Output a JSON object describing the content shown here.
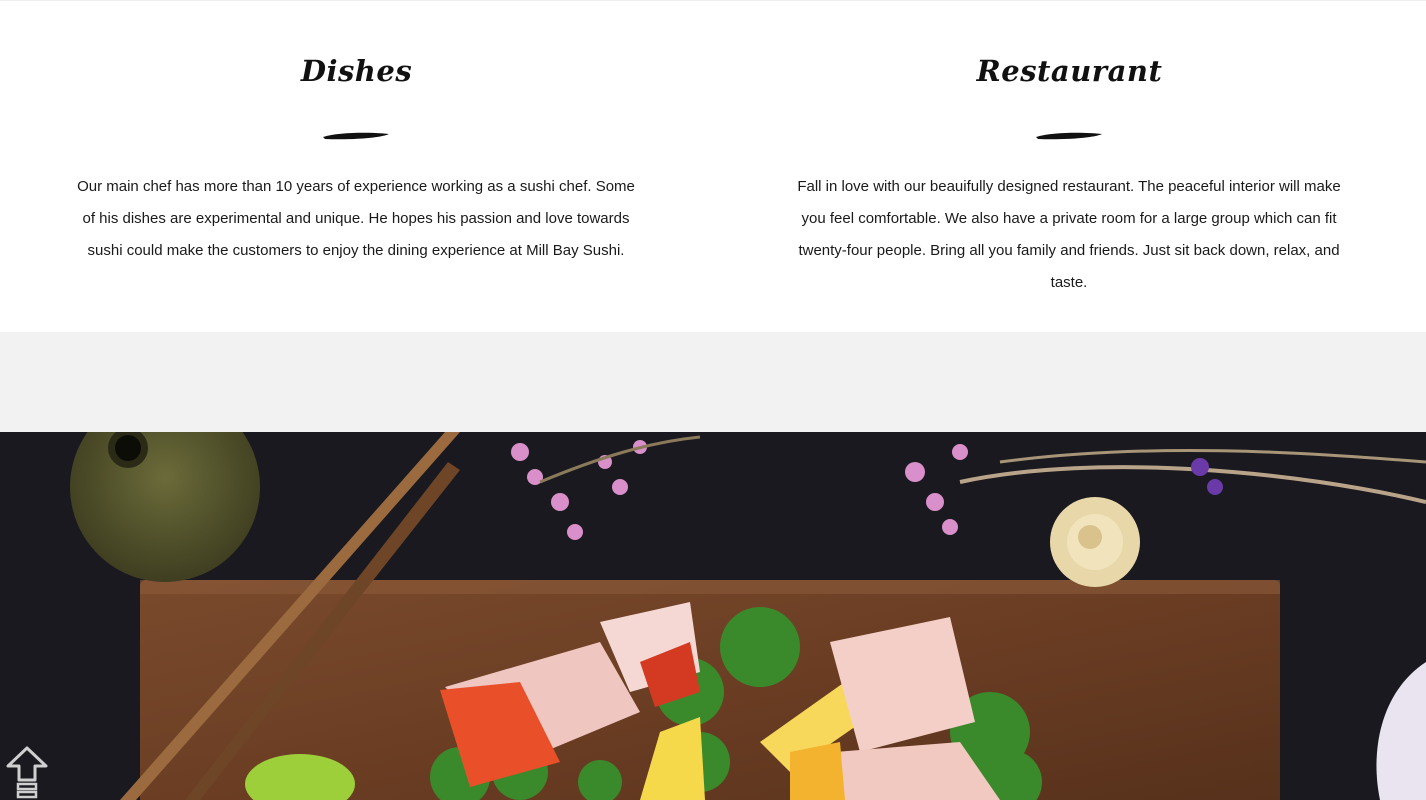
{
  "features": [
    {
      "title": "Dishes",
      "text": "Our main chef has more than 10 years of experience working as a sushi chef. Some of his dishes are experimental and unique. He hopes his passion and love towards sushi could make the customers to enjoy the dining experience at Mill Bay Sushi."
    },
    {
      "title": "Restaurant",
      "text": "Fall in love with our beauifully designed restaurant. The peaceful interior will make you feel comfortable. We also have a private room for a large group which can fit twenty-four people. Bring all you family and friends. Just sit back down, relax, and taste."
    }
  ],
  "hero": {
    "icon": "sashimi-platter-photo"
  },
  "back_to_top": {
    "icon": "arrow-up-icon"
  },
  "colors": {
    "text": "#1a1a1a",
    "band": "#f2f2f2",
    "hero_background": "#17161b"
  }
}
